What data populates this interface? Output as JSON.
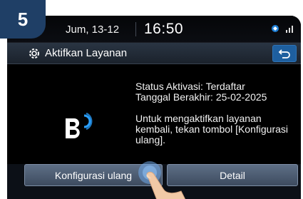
{
  "step": {
    "number": "5"
  },
  "statusbar": {
    "date": "Jum, 13-12",
    "time": "16:50"
  },
  "header": {
    "title": "Aktifkan Layanan",
    "icon": "gear-icon",
    "back_icon": "back-arrow-icon"
  },
  "content": {
    "status_line": "Status Aktivasi: Terdaftar",
    "expiry_line": "Tanggal Berakhir: 25-02-2025",
    "instruction_lines": [
      "Untuk mengaktifkan layanan",
      "kembali, tekan tombol [Konfigurasi",
      "ulang]."
    ]
  },
  "buttons": {
    "reconfigure": "Konfigurasi ulang",
    "detail": "Detail"
  },
  "colors": {
    "accent": "#1e5f9f",
    "badge": "#1f3f66",
    "logo_blue": "#2aa0ff"
  }
}
